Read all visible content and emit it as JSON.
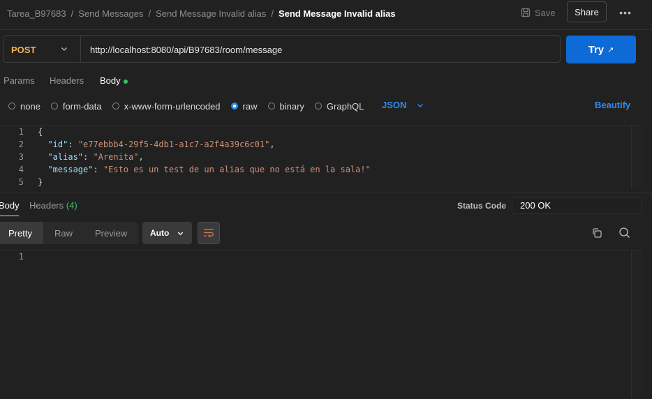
{
  "breadcrumb": {
    "items": [
      "Tarea_B97683",
      "Send Messages",
      "Send Message Invalid alias"
    ],
    "separator": "/",
    "current": "Send Message Invalid alias"
  },
  "header": {
    "save_label": "Save",
    "share_label": "Share",
    "more_label": "•••"
  },
  "request": {
    "method": "POST",
    "url": "http://localhost:8080/api/B97683/room/message",
    "try_label": "Try",
    "try_arrow": "↗"
  },
  "request_tabs": [
    "Params",
    "Headers",
    "Body"
  ],
  "body_types": {
    "options": [
      "none",
      "form-data",
      "x-www-form-urlencoded",
      "raw",
      "binary",
      "GraphQL"
    ],
    "selected": "raw",
    "format": "JSON",
    "beautify_label": "Beautify"
  },
  "request_body": {
    "line_numbers": [
      "1",
      "2",
      "3",
      "4",
      "5"
    ],
    "open": "{",
    "close": "}",
    "fields": [
      {
        "key": "\"id\"",
        "value": "\"e77ebbb4-29f5-4db1-a1c7-a2f4a39c6c01\"",
        "trail": ","
      },
      {
        "key": "\"alias\"",
        "value": "\"Arenita\"",
        "trail": ","
      },
      {
        "key": "\"message\"",
        "value": "\"Esto es un test de un alias que no está en la sala!\"",
        "trail": ""
      }
    ]
  },
  "response": {
    "tabs": [
      "Body",
      "Headers"
    ],
    "headers_count": "(4)",
    "status_label": "Status Code",
    "status_value": "200 OK",
    "views": [
      "Pretty",
      "Raw",
      "Preview"
    ],
    "format_select": "Auto",
    "line_numbers": [
      "1"
    ]
  },
  "colors": {
    "accent": "#0d6ad6",
    "method": "#f2b84b",
    "success": "#3fbf6a",
    "link": "#2d8cf0"
  }
}
